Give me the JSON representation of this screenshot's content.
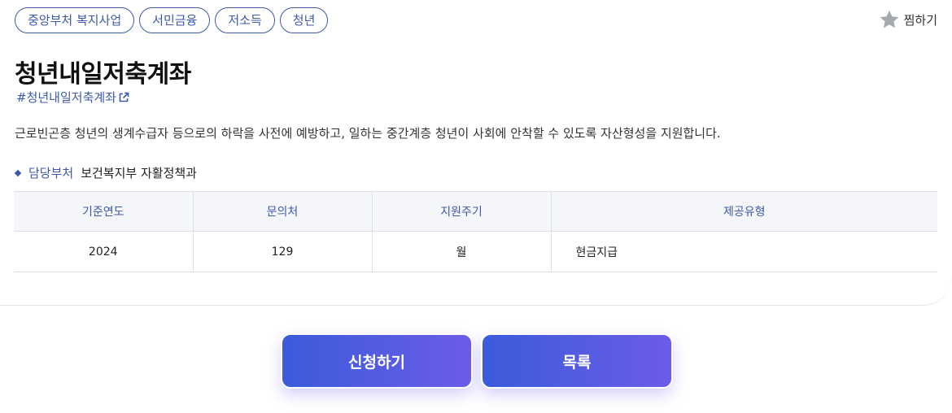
{
  "tags": [
    "중앙부처 복지사업",
    "서민금융",
    "저소득",
    "청년"
  ],
  "bookmark_label": "찜하기",
  "title": "청년내일저축계좌",
  "hashtag": "#청년내일저축계좌",
  "description": "근로빈곤층 청년의 생계수급자 등으로의 하락을 사전에 예방하고, 일하는 중간계층 청년이 사회에 안착할 수 있도록 자산형성을 지원합니다.",
  "department": {
    "label": "담당부처",
    "value": "보건복지부 자활정책과"
  },
  "table": {
    "headers": [
      "기준연도",
      "문의처",
      "지원주기",
      "제공유형"
    ],
    "row": [
      "2024",
      "129",
      "월",
      "현금지급"
    ]
  },
  "buttons": {
    "apply": "신청하기",
    "list": "목록"
  },
  "colors": {
    "accent": "#3d5aa8",
    "button_start": "#3b5bdb",
    "button_end": "#6c5ce7"
  }
}
